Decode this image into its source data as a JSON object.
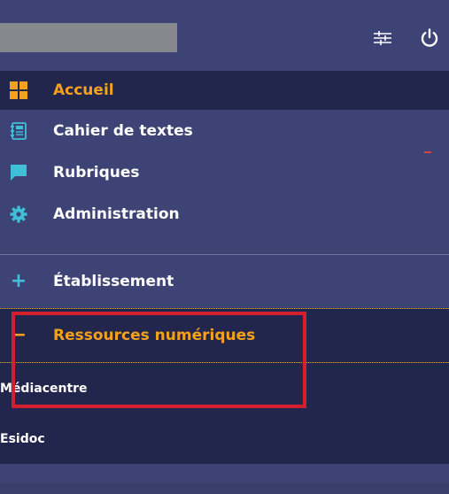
{
  "topbar": {
    "settings_icon": "sliders-icon",
    "power_icon": "power-icon"
  },
  "nav": {
    "items": [
      {
        "label": "Accueil",
        "icon": "grid-icon",
        "active": true
      },
      {
        "label": "Cahier de textes",
        "icon": "notebook-icon",
        "active": false
      },
      {
        "label": "Rubriques",
        "icon": "chat-icon",
        "active": false
      },
      {
        "label": "Administration",
        "icon": "gear-icon",
        "active": false
      }
    ],
    "sections": [
      {
        "sign": "+",
        "label": "Établissement",
        "open": false
      },
      {
        "sign": "−",
        "label": "Ressources numériques",
        "open": true,
        "children": [
          {
            "label": "Médiacentre"
          },
          {
            "label": "Esidoc"
          }
        ]
      }
    ]
  },
  "colors": {
    "panel": "#3e4375",
    "active_bg": "#22264d",
    "accent": "#f4a21e",
    "icon_cyan": "#3fc0d8",
    "highlight": "#d61f2c"
  }
}
